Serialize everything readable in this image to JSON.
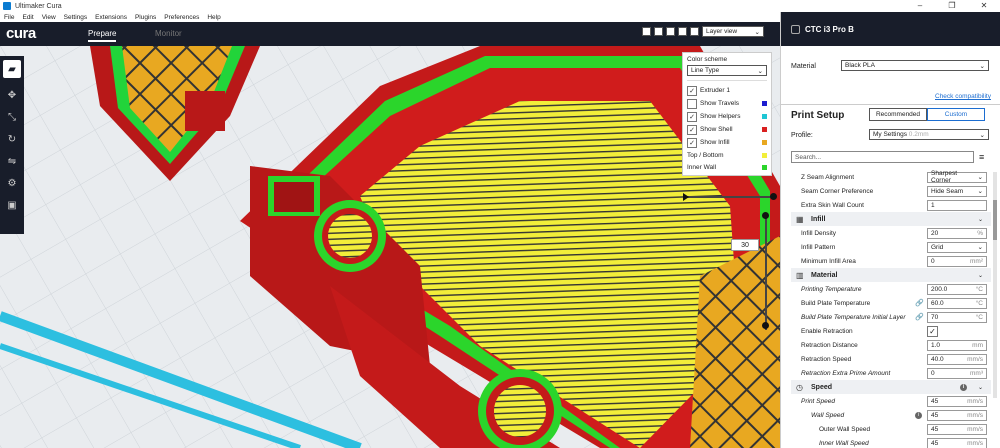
{
  "window": {
    "title": "Ultimaker Cura"
  },
  "menu": [
    "File",
    "Edit",
    "View",
    "Settings",
    "Extensions",
    "Plugins",
    "Preferences",
    "Help"
  ],
  "topbar": {
    "logo": "cura",
    "stages": [
      "Prepare",
      "Monitor"
    ]
  },
  "view": {
    "selected": "Layer view"
  },
  "legend": {
    "color_scheme_label": "Color scheme",
    "color_scheme_value": "Line Type",
    "items": [
      {
        "label": "Extruder 1",
        "checked": true,
        "color": ""
      },
      {
        "label": "Show Travels",
        "checked": false,
        "color": "#1d1dcf"
      },
      {
        "label": "Show Helpers",
        "checked": true,
        "color": "#1fc6d4"
      },
      {
        "label": "Show Shell",
        "checked": true,
        "color": "#d92020"
      },
      {
        "label": "Show Infill",
        "checked": true,
        "color": "#e8a821"
      }
    ],
    "plain": [
      {
        "label": "Top / Bottom",
        "color": "#f2ee3a"
      },
      {
        "label": "Inner Wall",
        "color": "#2bd52b"
      }
    ]
  },
  "layer": {
    "current": "30"
  },
  "panel": {
    "printer": "CTC i3 Pro B",
    "material_label": "Material",
    "material_value": "Black PLA",
    "compat_link": "Check compatibility",
    "print_setup": "Print Setup",
    "recommended": "Recommended",
    "custom": "Custom",
    "profile_label": "Profile:",
    "profile_value": "My Settings",
    "profile_hint": "0.2mm",
    "search_placeholder": "Search..."
  },
  "settings": [
    {
      "type": "row",
      "label": "Z Seam Alignment",
      "value": "Sharpest Corner",
      "kind": "select"
    },
    {
      "type": "row",
      "label": "Seam Corner Preference",
      "value": "Hide Seam",
      "kind": "select"
    },
    {
      "type": "row",
      "label": "Extra Skin Wall Count",
      "value": "1",
      "kind": "field",
      "unit": ""
    },
    {
      "type": "cat",
      "label": "Infill",
      "icon": "▦"
    },
    {
      "type": "row",
      "label": "Infill Density",
      "value": "20",
      "kind": "field",
      "unit": "%"
    },
    {
      "type": "row",
      "label": "Infill Pattern",
      "value": "Grid",
      "kind": "select"
    },
    {
      "type": "row",
      "label": "Minimum Infill Area",
      "value": "0",
      "kind": "field",
      "unit": "mm²"
    },
    {
      "type": "cat",
      "label": "Material",
      "icon": "▥"
    },
    {
      "type": "row",
      "label": "Printing Temperature",
      "value": "200.0",
      "kind": "field",
      "unit": "°C",
      "italic": true
    },
    {
      "type": "row",
      "label": "Build Plate Temperature",
      "value": "60.0",
      "kind": "field",
      "unit": "°C",
      "linked": true
    },
    {
      "type": "row",
      "label": "Build Plate Temperature Initial Layer",
      "value": "70",
      "kind": "field",
      "unit": "°C",
      "linked": true,
      "italic": true
    },
    {
      "type": "row",
      "label": "Enable Retraction",
      "value": "✓",
      "kind": "check"
    },
    {
      "type": "row",
      "label": "Retraction Distance",
      "value": "1.0",
      "kind": "field",
      "unit": "mm"
    },
    {
      "type": "row",
      "label": "Retraction Speed",
      "value": "40.0",
      "kind": "field",
      "unit": "mm/s"
    },
    {
      "type": "row",
      "label": "Retraction Extra Prime Amount",
      "value": "0",
      "kind": "field",
      "unit": "mm³",
      "italic": true
    },
    {
      "type": "cat",
      "label": "Speed",
      "icon": "◷",
      "info": true
    },
    {
      "type": "row",
      "label": "Print Speed",
      "value": "45",
      "kind": "field",
      "unit": "mm/s",
      "italic": true
    },
    {
      "type": "row",
      "label": "Wall Speed",
      "value": "45",
      "kind": "field",
      "unit": "mm/s",
      "indent": 1,
      "italic": true,
      "info": true
    },
    {
      "type": "row",
      "label": "Outer Wall Speed",
      "value": "45",
      "kind": "field",
      "unit": "mm/s",
      "indent": 2
    },
    {
      "type": "row",
      "label": "Inner Wall Speed",
      "value": "45",
      "kind": "field",
      "unit": "mm/s",
      "indent": 2,
      "italic": true
    }
  ]
}
